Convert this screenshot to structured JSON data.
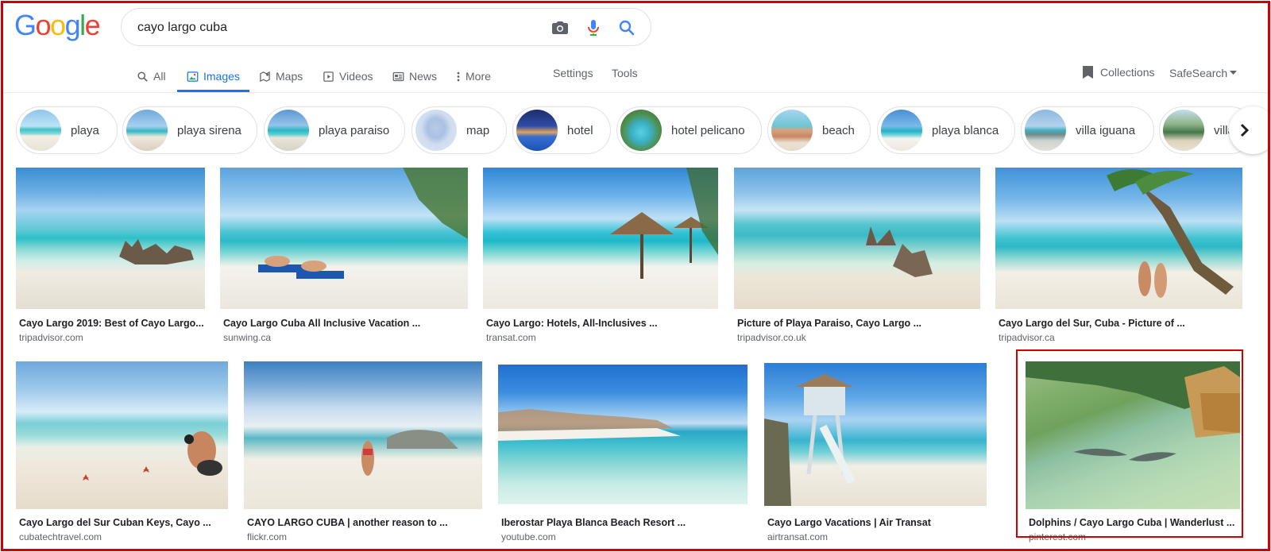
{
  "logo": {
    "letters": [
      "G",
      "o",
      "o",
      "g",
      "l",
      "e"
    ],
    "colors": [
      "#4285f4",
      "#ea4335",
      "#fbbc05",
      "#4285f4",
      "#34a853",
      "#ea4335"
    ]
  },
  "search": {
    "query": "cayo largo cuba",
    "icons": [
      "camera-icon",
      "microphone-icon",
      "search-icon"
    ]
  },
  "tabs": [
    {
      "label": "All",
      "icon": "search-icon",
      "active": false
    },
    {
      "label": "Images",
      "icon": "image-icon",
      "active": true
    },
    {
      "label": "Maps",
      "icon": "map-icon",
      "active": false
    },
    {
      "label": "Videos",
      "icon": "video-icon",
      "active": false
    },
    {
      "label": "News",
      "icon": "news-icon",
      "active": false
    },
    {
      "label": "More",
      "icon": "more-dots-icon",
      "active": false
    }
  ],
  "tools": {
    "settings": "Settings",
    "tools": "Tools"
  },
  "right_links": {
    "collections": "Collections",
    "safesearch": "SafeSearch"
  },
  "accent_color": "#1a73e8",
  "chips": [
    {
      "label": "playa"
    },
    {
      "label": "playa sirena"
    },
    {
      "label": "playa paraiso"
    },
    {
      "label": "map"
    },
    {
      "label": "hotel"
    },
    {
      "label": "hotel pelicano"
    },
    {
      "label": "beach"
    },
    {
      "label": "playa blanca"
    },
    {
      "label": "villa iguana"
    },
    {
      "label": "villa"
    }
  ],
  "results": [
    {
      "title": "Cayo Largo 2019: Best of Cayo Largo...",
      "source": "tripadvisor.com"
    },
    {
      "title": "Cayo Largo Cuba All Inclusive Vacation ...",
      "source": "sunwing.ca"
    },
    {
      "title": "Cayo Largo: Hotels, All-Inclusives ...",
      "source": "transat.com"
    },
    {
      "title": "Picture of Playa Paraiso, Cayo Largo ...",
      "source": "tripadvisor.co.uk"
    },
    {
      "title": "Cayo Largo del Sur, Cuba - Picture of ...",
      "source": "tripadvisor.ca"
    },
    {
      "title": "Cayo Largo del Sur Cuban Keys, Cayo ...",
      "source": "cubatechtravel.com"
    },
    {
      "title": "CAYO LARGO CUBA | another reason to ...",
      "source": "flickr.com"
    },
    {
      "title": "Iberostar Playa Blanca Beach Resort ...",
      "source": "youtube.com"
    },
    {
      "title": "Cayo Largo Vacations | Air Transat",
      "source": "airtransat.com"
    },
    {
      "title": "Dolphins / Cayo Largo Cuba | Wanderlust ...",
      "source": "pinterest.com",
      "highlighted": true
    }
  ],
  "highlight_color": "#d00000"
}
